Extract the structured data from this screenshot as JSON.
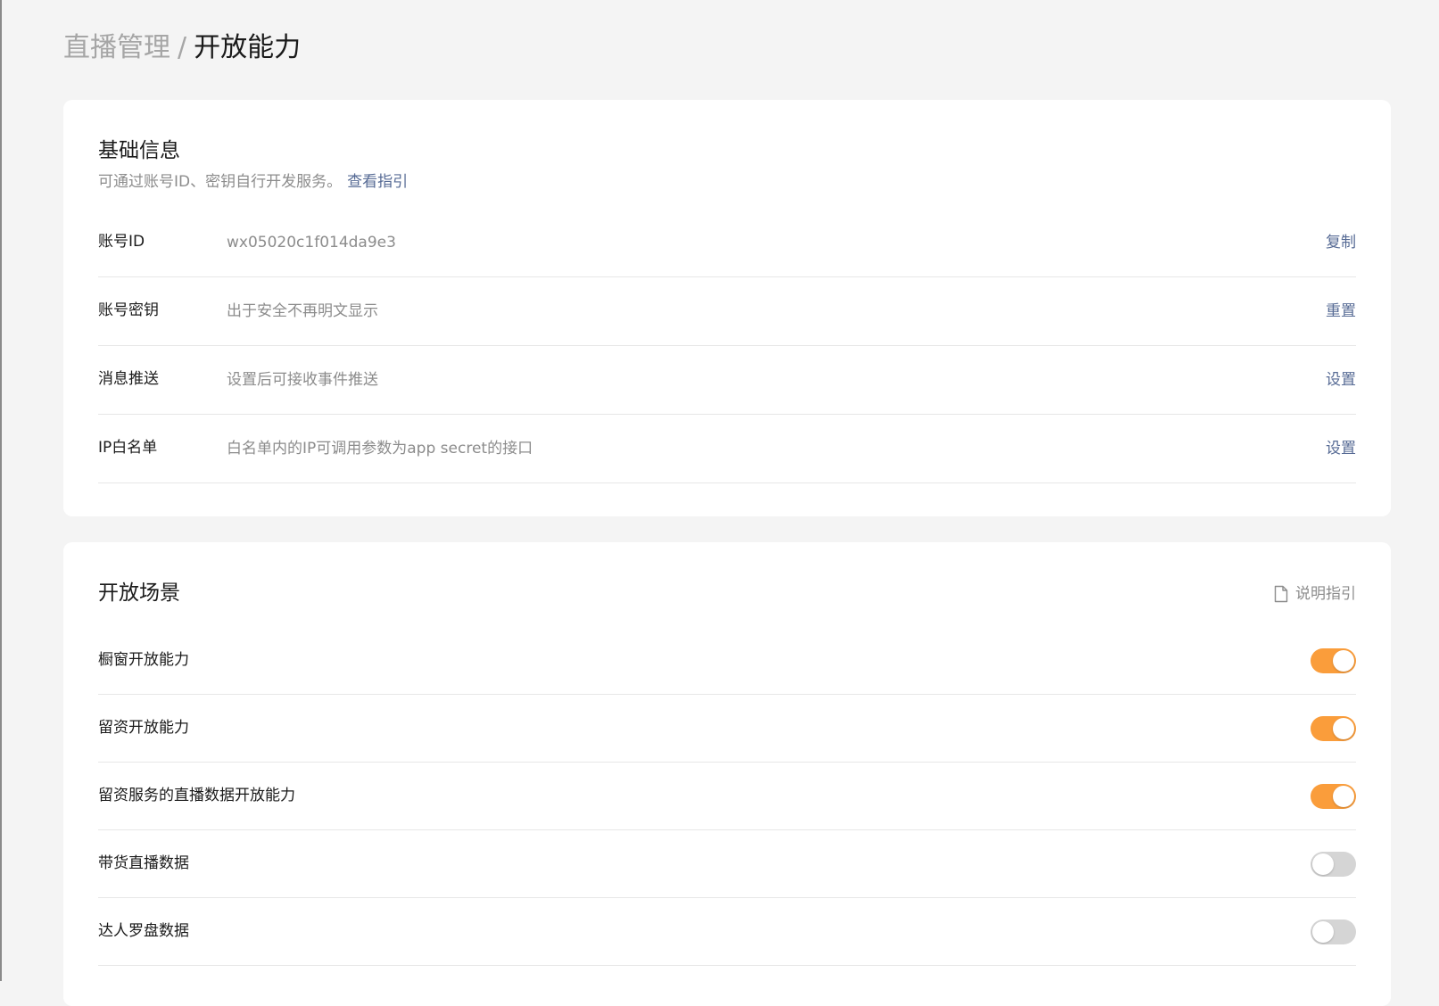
{
  "breadcrumb": {
    "parent": "直播管理",
    "separator": "/",
    "current": "开放能力"
  },
  "basic": {
    "title": "基础信息",
    "desc": "可通过账号ID、密钥自行开发服务。",
    "desc_link": "查看指引",
    "rows": [
      {
        "label": "账号ID",
        "value": "wx05020c1f014da9e3",
        "action": "复制"
      },
      {
        "label": "账号密钥",
        "value": "出于安全不再明文显示",
        "action": "重置"
      },
      {
        "label": "消息推送",
        "value": "设置后可接收事件推送",
        "action": "设置"
      },
      {
        "label": "IP白名单",
        "value": "白名单内的IP可调用参数为app secret的接口",
        "action": "设置"
      }
    ]
  },
  "scenes": {
    "title": "开放场景",
    "guide_label": "说明指引",
    "guide_icon": "document-icon",
    "items": [
      {
        "label": "橱窗开放能力",
        "enabled": true
      },
      {
        "label": "留资开放能力",
        "enabled": true
      },
      {
        "label": "留资服务的直播数据开放能力",
        "enabled": true
      },
      {
        "label": "带货直播数据",
        "enabled": false
      },
      {
        "label": "达人罗盘数据",
        "enabled": false
      }
    ]
  },
  "colors": {
    "accent": "#fa9d3b",
    "link": "#576b95",
    "toggle_off": "#d5d5d5"
  }
}
